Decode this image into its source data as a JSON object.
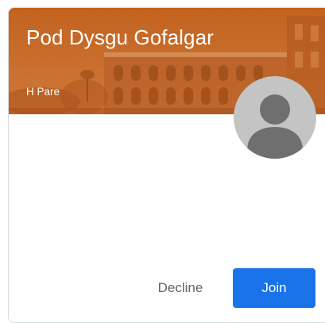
{
  "class_card": {
    "title": "Pod Dysgu Gofalgar",
    "teacher": "H Pare",
    "banner_color": "#c8682a",
    "avatar_icon": "default-person-avatar-icon",
    "actions": {
      "decline_label": "Decline",
      "join_label": "Join"
    },
    "colors": {
      "join_button": "#1a73e8",
      "decline_text": "#5f6368",
      "avatar_bg": "#c4c4c4",
      "avatar_figure": "#6f6f6f"
    }
  }
}
